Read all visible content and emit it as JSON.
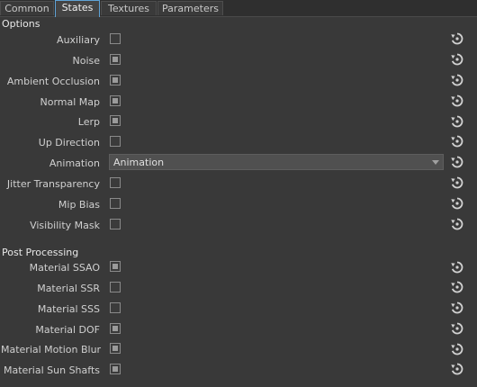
{
  "tabs": [
    "Common",
    "States",
    "Textures",
    "Parameters"
  ],
  "active_tab": "States",
  "options": {
    "title": "Options",
    "rows": [
      {
        "label": "Auxiliary",
        "type": "checkbox",
        "checked": false
      },
      {
        "label": "Noise",
        "type": "checkbox",
        "checked": true
      },
      {
        "label": "Ambient Occlusion",
        "type": "checkbox",
        "checked": true
      },
      {
        "label": "Normal Map",
        "type": "checkbox",
        "checked": true
      },
      {
        "label": "Lerp",
        "type": "checkbox",
        "checked": true
      },
      {
        "label": "Up Direction",
        "type": "checkbox",
        "checked": false
      },
      {
        "label": "Animation",
        "type": "dropdown",
        "value": "Animation"
      },
      {
        "label": "Jitter Transparency",
        "type": "checkbox",
        "checked": false
      },
      {
        "label": "Mip Bias",
        "type": "checkbox",
        "checked": false
      },
      {
        "label": "Visibility Mask",
        "type": "checkbox",
        "checked": false
      }
    ]
  },
  "post_processing": {
    "title": "Post Processing",
    "rows": [
      {
        "label": "Material SSAO",
        "type": "checkbox",
        "checked": true
      },
      {
        "label": "Material SSR",
        "type": "checkbox",
        "checked": false
      },
      {
        "label": "Material SSS",
        "type": "checkbox",
        "checked": false
      },
      {
        "label": "Material DOF",
        "type": "checkbox",
        "checked": true
      },
      {
        "label": "Material Motion Blur",
        "type": "checkbox",
        "checked": true
      },
      {
        "label": "Material Sun Shafts",
        "type": "checkbox",
        "checked": true
      }
    ]
  },
  "reset_icon": "reset-icon"
}
